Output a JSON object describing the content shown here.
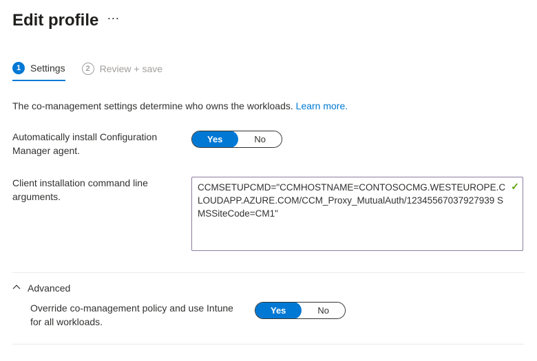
{
  "page": {
    "title": "Edit profile"
  },
  "tabs": {
    "step1": {
      "num": "1",
      "label": "Settings"
    },
    "step2": {
      "num": "2",
      "label": "Review + save"
    }
  },
  "intro": {
    "text": "The co-management settings determine who owns the workloads. ",
    "link": "Learn more."
  },
  "fields": {
    "autoInstall": {
      "label": "Automatically install Configuration Manager agent.",
      "yes": "Yes",
      "no": "No"
    },
    "cmdline": {
      "label": "Client installation command line arguments.",
      "value": "CCMSETUPCMD=\"CCMHOSTNAME=CONTOSOCMG.WESTEUROPE.CLOUDAPP.AZURE.COM/CCM_Proxy_MutualAuth/12345567037927939 SMSSiteCode=CM1\""
    }
  },
  "advanced": {
    "title": "Advanced",
    "override": {
      "label": "Override co-management policy and use Intune for all workloads.",
      "yes": "Yes",
      "no": "No"
    }
  }
}
